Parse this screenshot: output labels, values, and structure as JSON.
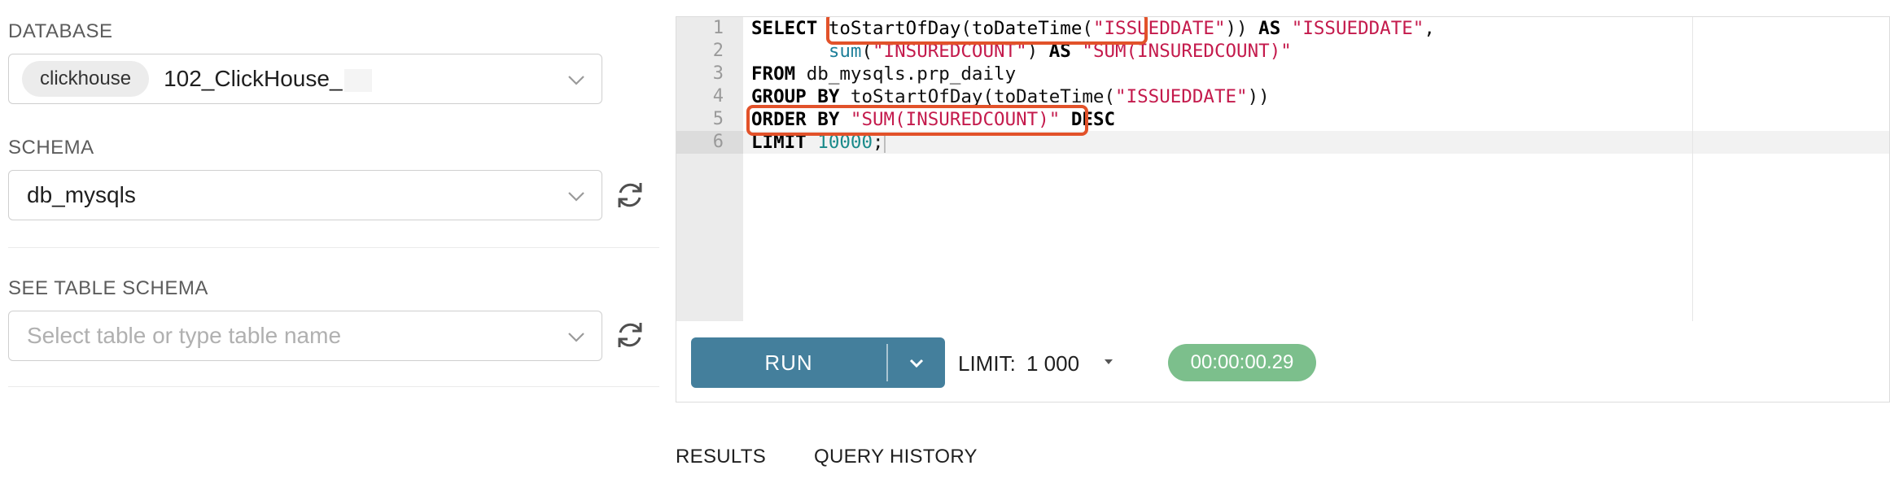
{
  "left_panel": {
    "database": {
      "label": "DATABASE",
      "backend_tag": "clickhouse",
      "value": "102_ClickHouse_"
    },
    "schema": {
      "label": "SCHEMA",
      "value": "db_mysqls"
    },
    "table_schema": {
      "label": "SEE TABLE SCHEMA",
      "placeholder": "Select table or type table name"
    }
  },
  "editor": {
    "line_numbers": [
      "1",
      "2",
      "3",
      "4",
      "5",
      "6"
    ],
    "lines": [
      [
        {
          "t": "SELECT",
          "c": "kw"
        },
        {
          "t": " ",
          "c": "txt"
        },
        {
          "t": "toStartOfDay",
          "c": "fn"
        },
        {
          "t": "(",
          "c": "txt"
        },
        {
          "t": "toDateTime",
          "c": "fn"
        },
        {
          "t": "(",
          "c": "txt"
        },
        {
          "t": "\"ISSUEDDATE\"",
          "c": "str"
        },
        {
          "t": "))",
          "c": "txt"
        },
        {
          "t": " ",
          "c": "txt"
        },
        {
          "t": "AS",
          "c": "kw"
        },
        {
          "t": " ",
          "c": "txt"
        },
        {
          "t": "\"ISSUEDDATE\"",
          "c": "str"
        },
        {
          "t": ",",
          "c": "txt"
        }
      ],
      [
        {
          "t": "       ",
          "c": "txt"
        },
        {
          "t": "sum",
          "c": "fn2"
        },
        {
          "t": "(",
          "c": "txt"
        },
        {
          "t": "\"INSUREDCOUNT\"",
          "c": "str"
        },
        {
          "t": ")",
          "c": "txt"
        },
        {
          "t": " ",
          "c": "txt"
        },
        {
          "t": "AS",
          "c": "kw"
        },
        {
          "t": " ",
          "c": "txt"
        },
        {
          "t": "\"SUM(INSUREDCOUNT)\"",
          "c": "str"
        }
      ],
      [
        {
          "t": "FROM",
          "c": "kw"
        },
        {
          "t": " db_mysqls.prp_daily",
          "c": "txt"
        }
      ],
      [
        {
          "t": "GROUP BY",
          "c": "kw"
        },
        {
          "t": " toStartOfDay(toDateTime(",
          "c": "txt"
        },
        {
          "t": "\"ISSUEDDATE\"",
          "c": "str"
        },
        {
          "t": "))",
          "c": "txt"
        }
      ],
      [
        {
          "t": "ORDER BY",
          "c": "kw"
        },
        {
          "t": " ",
          "c": "txt"
        },
        {
          "t": "\"SUM(INSUREDCOUNT)\"",
          "c": "str"
        },
        {
          "t": " ",
          "c": "txt"
        },
        {
          "t": "DESC",
          "c": "kw"
        }
      ],
      [
        {
          "t": "LIMIT",
          "c": "kw"
        },
        {
          "t": " ",
          "c": "txt"
        },
        {
          "t": "10000",
          "c": "num"
        },
        {
          "t": ";",
          "c": "txt"
        }
      ]
    ],
    "active_line": 6,
    "highlight_color": "#e2522a"
  },
  "toolbar": {
    "run_label": "RUN",
    "limit_label": "LIMIT:",
    "limit_value": "1 000",
    "timer": "00:00:00.29",
    "run_color": "#447f9c",
    "timer_color": "#7cbf8c"
  },
  "tabs": {
    "results": "RESULTS",
    "query_history": "QUERY HISTORY"
  }
}
